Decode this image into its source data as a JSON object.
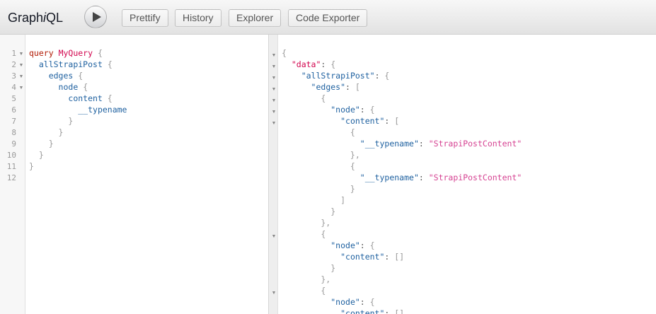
{
  "app": {
    "title_prefix": "Graph",
    "title_italic": "i",
    "title_suffix": "QL"
  },
  "toolbar": {
    "run_label": "Execute Query",
    "prettify_label": "Prettify",
    "history_label": "History",
    "explorer_label": "Explorer",
    "code_exporter_label": "Code Exporter"
  },
  "query_editor": {
    "line_numbers": [
      "1",
      "2",
      "3",
      "4",
      "5",
      "6",
      "7",
      "8",
      "9",
      "10",
      "11",
      "12"
    ],
    "keyword": "query",
    "operation_name": "MyQuery",
    "root_field": "allStrapiPost",
    "edges_field": "edges",
    "node_field": "node",
    "content_field": "content",
    "typename_field": "__typename"
  },
  "result": {
    "data_key": "\"data\"",
    "all_key": "\"allStrapiPost\"",
    "edges_key": "\"edges\"",
    "node_key": "\"node\"",
    "content_key": "\"content\"",
    "typename_key": "\"__typename\"",
    "typename_value": "\"StrapiPostContent\""
  }
}
